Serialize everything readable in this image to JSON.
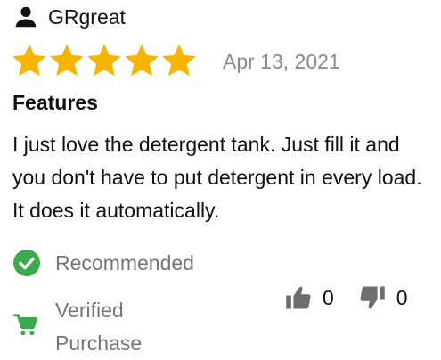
{
  "review": {
    "author": "GRgreat",
    "rating": 5,
    "rating_max": 5,
    "date": "Apr 13, 2021",
    "title": "Features",
    "body": "I just love the detergent tank. Just fill it and you don't have to put detergent in every load. It does it automatically.",
    "recommended_label": "Recommended",
    "verified_label": "Verified Purchase",
    "helpful_count": "0",
    "unhelpful_count": "0"
  },
  "icons": {
    "author": "user-icon",
    "star": "star-icon",
    "recommended": "check-circle-icon",
    "verified": "shopping-cart-icon",
    "helpful": "thumbs-up-icon",
    "unhelpful": "thumbs-down-icon"
  },
  "colors": {
    "star": "#F7B500",
    "check": "#3BAA4B",
    "cart": "#3BAA4B",
    "muted_text": "#757575",
    "date_text": "#8a8a8a",
    "vote_icon": "#6e6e6e"
  }
}
